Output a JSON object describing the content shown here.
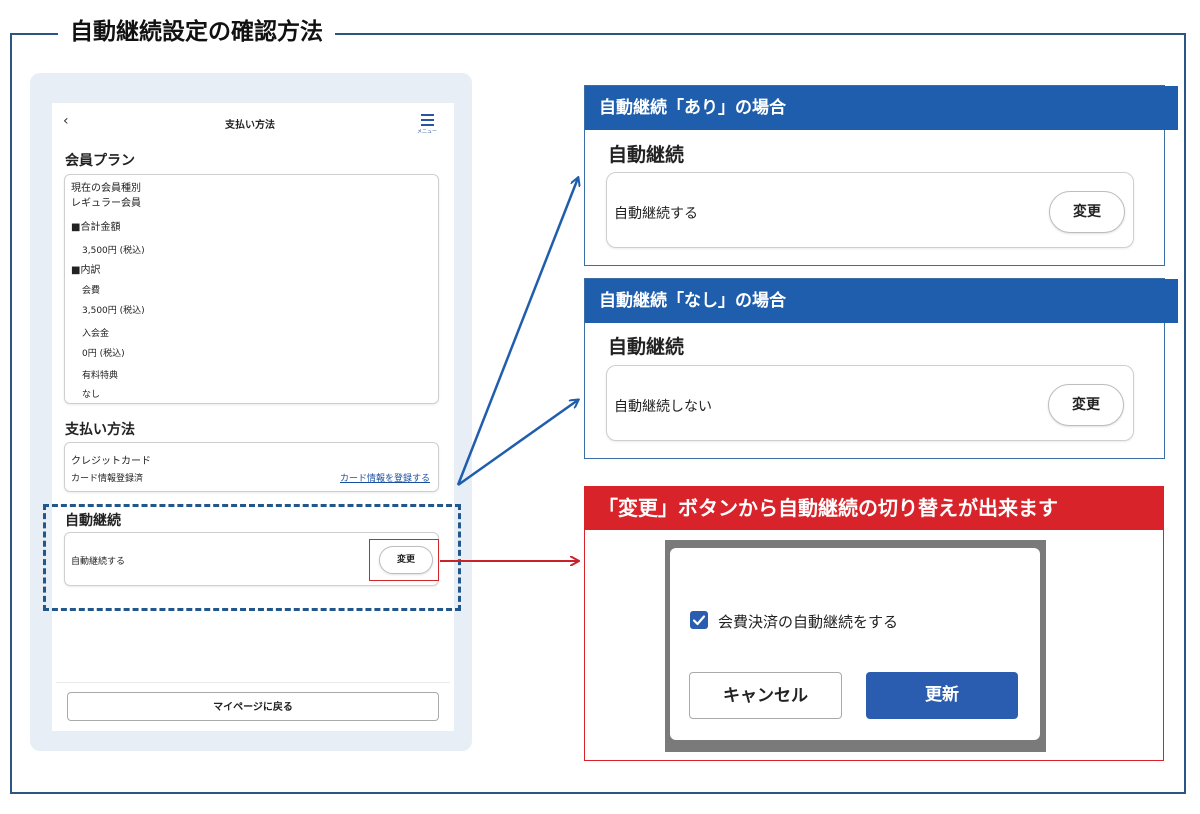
{
  "title": "自動継続設定の確認方法",
  "phone": {
    "back_icon": "chevron-left-icon",
    "header_title": "支払い方法",
    "menu_label": "メニュー",
    "plan_section": "会員プラン",
    "plan_card": {
      "current_type_label": "現在の会員種別",
      "current_type_value": "レギュラー会員",
      "total_heading": "■合計金額",
      "total_value": "3,500円 (税込)",
      "breakdown_heading": "■内訳",
      "items": [
        {
          "label": "会費",
          "value": "3,500円 (税込)"
        },
        {
          "label": "入会金",
          "value": "0円 (税込)"
        },
        {
          "label": "有料特典",
          "value": "なし"
        }
      ]
    },
    "payment_section": "支払い方法",
    "payment_card": {
      "method": "クレジットカード",
      "status": "カード情報登録済",
      "link": "カード情報を登録する"
    },
    "auto_section": "自動継続",
    "auto_card": {
      "value": "自動継続する",
      "button": "変更"
    },
    "mypage_button": "マイページに戻る"
  },
  "panel_on": {
    "header": "自動継続「あり」の場合",
    "sub": "自動継続",
    "value": "自動継続する",
    "button": "変更"
  },
  "panel_off": {
    "header": "自動継続「なし」の場合",
    "sub": "自動継続",
    "value": "自動継続しない",
    "button": "変更"
  },
  "panel_change": {
    "header": "「変更」ボタンから自動継続の切り替えが出来ます",
    "checkbox_label": "会費決済の自動継続をする",
    "checkbox_checked": true,
    "cancel_button": "キャンセル",
    "update_button": "更新"
  },
  "colors": {
    "brand_blue": "#1f5eac",
    "frame_blue": "#2b5585",
    "accent_red": "#d8232a",
    "primary_button": "#2a5db0"
  }
}
